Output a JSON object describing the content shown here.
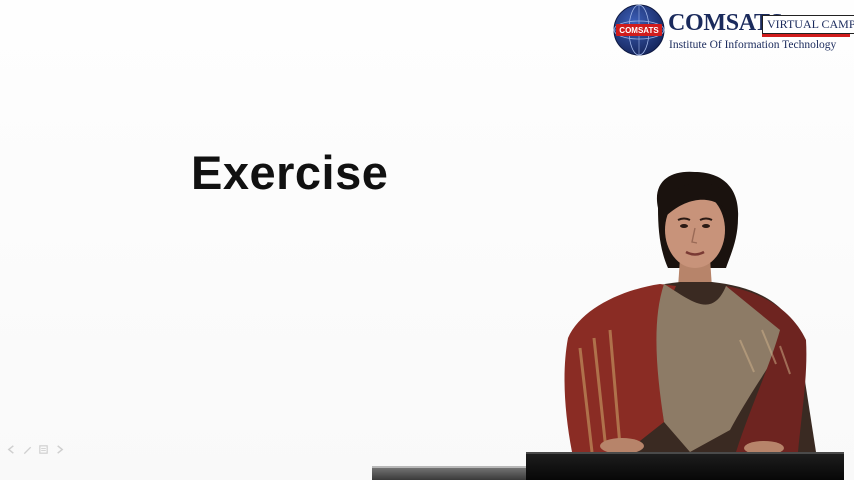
{
  "slide": {
    "title": "Exercise"
  },
  "branding": {
    "name": "COMSATS",
    "emblem_text": "COMSATS",
    "tag": "VIRTUAL CAMPUS",
    "subtitle": "Institute Of Information Technology",
    "colors": {
      "navy": "#1a2a5c",
      "accent_red": "#d01c1c"
    }
  },
  "slide_controls": [
    {
      "icon": "previous-arrow-icon"
    },
    {
      "icon": "pen-icon"
    },
    {
      "icon": "menu-icon"
    },
    {
      "icon": "next-arrow-icon"
    }
  ],
  "scene": {
    "presenter": "person-icon",
    "lectern": "lectern-icon"
  }
}
